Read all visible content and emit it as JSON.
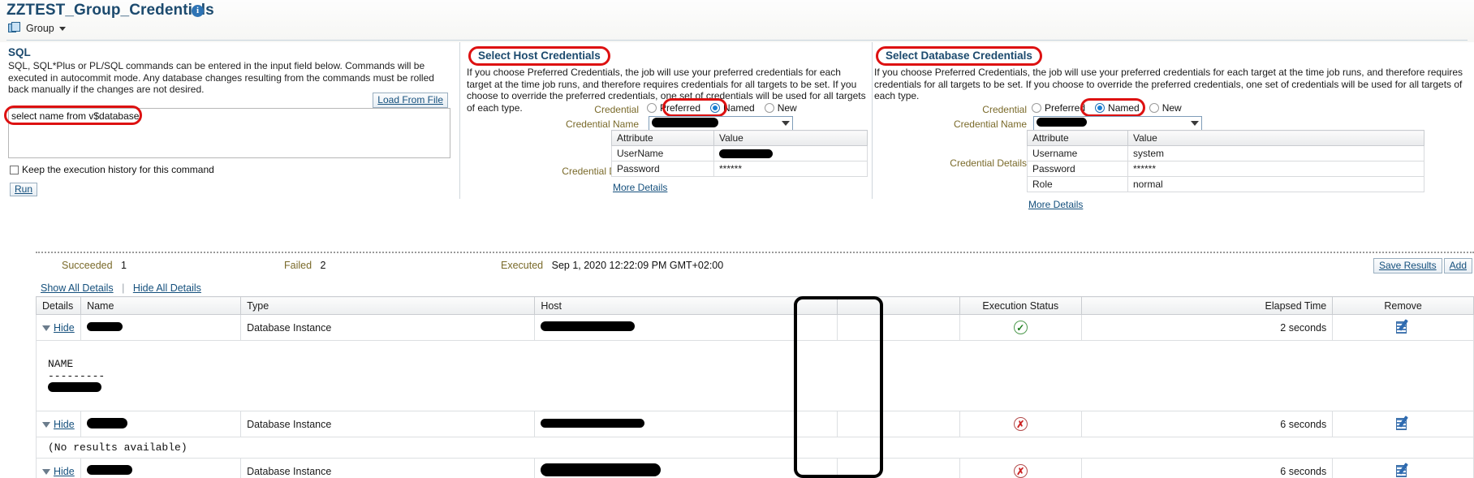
{
  "header": {
    "title": "ZZTEST_Group_Credentials",
    "info_icon": "info-icon",
    "target_type_label": "Group",
    "target_icon": "group-icon",
    "dropdown_icon": "chevron-down-icon"
  },
  "sql_panel": {
    "section_title": "SQL",
    "description": "SQL, SQL*Plus or PL/SQL commands can be entered in the input field below. Commands will be executed in autocommit mode. Any database changes resulting from the commands must be rolled back manually if the changes are not desired.",
    "load_from_file_label": "Load From File",
    "sql_value": "select name from v$database;",
    "sql_placeholder": "",
    "keep_history_label": "Keep the execution history for this command",
    "keep_history_checked": false,
    "run_label": "Run"
  },
  "host_credentials": {
    "section_title": "Select Host Credentials",
    "description": "If you choose Preferred Credentials, the job will use your preferred credentials for each target at the time job runs, and therefore requires credentials for all targets to be set. If you choose to override the preferred credentials, one set of credentials will be used for all targets of each type.",
    "credential_label": "Credential",
    "options": [
      "Preferred",
      "Named",
      "New"
    ],
    "selected_option": "Named",
    "credential_name_label": "Credential Name",
    "credential_name_value": "",
    "credential_details_label": "Credential Details",
    "table_headers": [
      "Attribute",
      "Value"
    ],
    "rows": [
      {
        "attribute": "UserName",
        "value": "",
        "redacted": true
      },
      {
        "attribute": "Password",
        "value": "******",
        "redacted": false
      }
    ],
    "more_details_label": "More Details"
  },
  "database_credentials": {
    "section_title": "Select Database Credentials",
    "description": "If you choose Preferred Credentials, the job will use your preferred credentials for each target at the time job runs, and therefore requires credentials for all targets to be set. If you choose to override the preferred credentials, one set of credentials will be used for all targets of each type.",
    "credential_label": "Credential",
    "options": [
      "Preferred",
      "Named",
      "New"
    ],
    "selected_option": "Named",
    "credential_name_label": "Credential Name",
    "credential_name_value": "",
    "credential_details_label": "Credential Details",
    "table_headers": [
      "Attribute",
      "Value"
    ],
    "rows": [
      {
        "attribute": "Username",
        "value": "system",
        "redacted": false
      },
      {
        "attribute": "Password",
        "value": "******",
        "redacted": false
      },
      {
        "attribute": "Role",
        "value": "normal",
        "redacted": false
      }
    ],
    "more_details_label": "More Details"
  },
  "results": {
    "succeeded_label": "Succeeded",
    "succeeded_count": "1",
    "failed_label": "Failed",
    "failed_count": "2",
    "executed_label": "Executed",
    "executed_time": "Sep 1, 2020 12:22:09 PM GMT+02:00",
    "show_all_details_label": "Show All Details",
    "hide_all_details_label": "Hide All Details",
    "save_results_label": "Save Results",
    "add_label": "Add",
    "columns": [
      "Details",
      "Name",
      "Type",
      "Host",
      "Execution Status",
      "Elapsed Time",
      "Remove"
    ],
    "rows": [
      {
        "details_label": "Hide",
        "name": "",
        "name_redacted": true,
        "type": "Database Instance",
        "host": "",
        "host_redacted": true,
        "status": "success",
        "status_icon": "check-circle-icon",
        "elapsed": "2 seconds",
        "remove_icon": "edit-pencil-icon",
        "detail_output": "NAME\n---------\n"
      },
      {
        "details_label": "Hide",
        "name": "",
        "name_redacted": true,
        "type": "Database Instance",
        "host": "",
        "host_redacted": true,
        "status": "error",
        "status_icon": "error-circle-icon",
        "elapsed": "6 seconds",
        "remove_icon": "edit-pencil-icon",
        "detail_output": "(No results available)"
      },
      {
        "details_label": "Hide",
        "name": "",
        "name_redacted": true,
        "type": "Database Instance",
        "host": "",
        "host_redacted": true,
        "status": "error",
        "status_icon": "error-circle-icon",
        "elapsed": "6 seconds",
        "remove_icon": "edit-pencil-icon",
        "detail_output": ""
      }
    ]
  },
  "annotations": {
    "highlight_color": "#dd1111",
    "box_color": "#000000",
    "link_color": "#15507d",
    "label_color": "#7a6a2a",
    "title_color": "#1c4a6e"
  }
}
